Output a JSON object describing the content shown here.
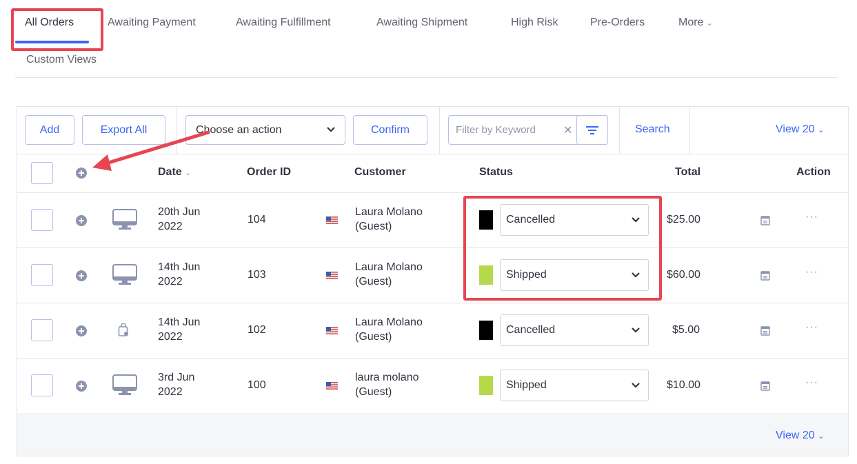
{
  "tabs": {
    "items": [
      "All Orders",
      "Awaiting Payment",
      "Awaiting Fulfillment",
      "Awaiting Shipment",
      "High Risk",
      "Pre-Orders",
      "More"
    ],
    "custom_views": "Custom Views"
  },
  "toolbar": {
    "add_label": "Add",
    "export_label": "Export All",
    "action_select": "Choose an action",
    "confirm_label": "Confirm",
    "filter_placeholder": "Filter by Keyword",
    "search_label": "Search",
    "view_label": "View 20"
  },
  "table": {
    "headers": {
      "date": "Date",
      "order_id": "Order ID",
      "customer": "Customer",
      "status": "Status",
      "total": "Total",
      "action": "Action"
    },
    "rows": [
      {
        "date_line1": "20th Jun",
        "date_line2": "2022",
        "order_id": "104",
        "customer_line1": "Laura Molano",
        "customer_line2": "(Guest)",
        "status": "Cancelled",
        "status_color": "#000000",
        "total": "$25.00",
        "device_icon": "monitor-icon"
      },
      {
        "date_line1": "14th Jun",
        "date_line2": "2022",
        "order_id": "103",
        "customer_line1": "Laura Molano",
        "customer_line2": "(Guest)",
        "status": "Shipped",
        "status_color": "#b5d94a",
        "total": "$60.00",
        "device_icon": "monitor-icon"
      },
      {
        "date_line1": "14th Jun",
        "date_line2": "2022",
        "order_id": "102",
        "customer_line1": "Laura Molano",
        "customer_line2": "(Guest)",
        "status": "Cancelled",
        "status_color": "#000000",
        "total": "$5.00",
        "device_icon": "shopping-bag-icon"
      },
      {
        "date_line1": "3rd Jun",
        "date_line2": "2022",
        "order_id": "100",
        "customer_line1": "laura molano",
        "customer_line2": "(Guest)",
        "status": "Shipped",
        "status_color": "#b5d94a",
        "total": "$10.00",
        "device_icon": "monitor-icon"
      }
    ]
  },
  "footer": {
    "view_label": "View 20"
  },
  "colors": {
    "accent": "#3c64f4",
    "annotation": "#e74552",
    "border": "#e2e4ea"
  }
}
